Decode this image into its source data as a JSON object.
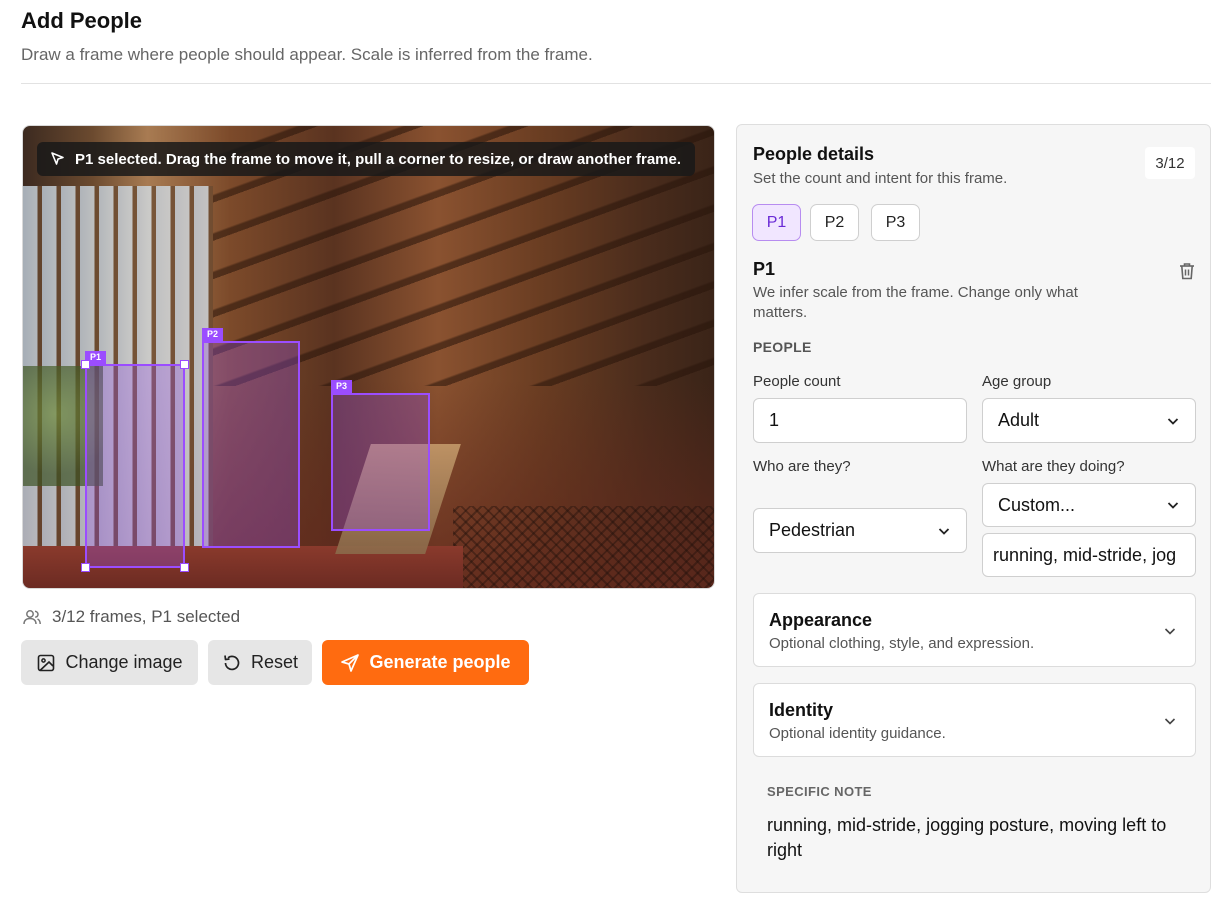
{
  "header": {
    "title": "Add People",
    "subtitle": "Draw a frame where people should appear. Scale is inferred from the frame."
  },
  "canvas": {
    "toast": "P1 selected. Drag the frame to move it, pull a corner to resize, or draw another frame.",
    "frames": [
      {
        "label": "P1",
        "selected": true
      },
      {
        "label": "P2",
        "selected": false
      },
      {
        "label": "P3",
        "selected": false
      }
    ]
  },
  "status": {
    "frames_text": "3/12 frames, P1 selected"
  },
  "actions": {
    "change_image": "Change image",
    "reset": "Reset",
    "generate": "Generate people"
  },
  "panel": {
    "title": "People details",
    "subtitle": "Set the count and intent for this frame.",
    "count": "3/12",
    "tabs": [
      {
        "label": "P1",
        "active": true
      },
      {
        "label": "P2",
        "active": false
      },
      {
        "label": "P3",
        "active": false
      }
    ],
    "selected": {
      "heading": "P1",
      "description": "We infer scale from the frame. Change only what matters.",
      "section_label": "PEOPLE",
      "people_count_label": "People count",
      "people_count_value": "1",
      "age_group_label": "Age group",
      "age_group_value": "Adult",
      "who_label": "Who are they?",
      "who_value": "Pedestrian",
      "doing_label": "What are they doing?",
      "doing_value": "Custom...",
      "doing_custom_value": "running, mid-stride, jog"
    },
    "appearance": {
      "title": "Appearance",
      "subtitle": "Optional clothing, style, and expression."
    },
    "identity": {
      "title": "Identity",
      "subtitle": "Optional identity guidance."
    },
    "note": {
      "label": "SPECIFIC NOTE",
      "text": "running, mid-stride, jogging posture, moving left to right"
    }
  },
  "colors": {
    "accent": "#9b4dff",
    "primary_button": "#ff6b10",
    "tab_active_bg": "#f1e6ff"
  },
  "icons": {
    "toast": "cursor-icon",
    "status": "users-icon",
    "change_image": "image-icon",
    "reset": "rotate-ccw-icon",
    "generate": "send-icon",
    "delete": "trash-icon",
    "select": "chevron-down-icon"
  }
}
